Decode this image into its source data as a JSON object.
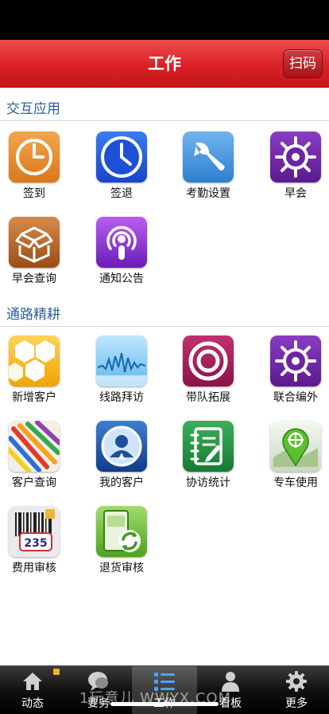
{
  "header": {
    "title": "工作",
    "scan_label": "扫码"
  },
  "sections": [
    {
      "title": "交互应用",
      "items": [
        {
          "label": "签到",
          "icon": "clock-icon"
        },
        {
          "label": "签退",
          "icon": "clock-icon"
        },
        {
          "label": "考勤设置",
          "icon": "wrench-icon"
        },
        {
          "label": "早会",
          "icon": "helm-icon"
        },
        {
          "label": "早会查询",
          "icon": "box-icon"
        },
        {
          "label": "通知公告",
          "icon": "podcast-icon"
        }
      ]
    },
    {
      "title": "通路精耕",
      "items": [
        {
          "label": "新增客户",
          "icon": "hexagon-icon"
        },
        {
          "label": "线路拜访",
          "icon": "waveform-icon"
        },
        {
          "label": "带队拓展",
          "icon": "ring-icon"
        },
        {
          "label": "联合编外",
          "icon": "helm-icon"
        },
        {
          "label": "客户查询",
          "icon": "pencils-icon"
        },
        {
          "label": "我的客户",
          "icon": "user-icon"
        },
        {
          "label": "协访统计",
          "icon": "notebook-icon"
        },
        {
          "label": "专车使用",
          "icon": "map-pin-icon"
        },
        {
          "label": "费用审核",
          "icon": "barcode-icon"
        },
        {
          "label": "退货审核",
          "icon": "refresh-icon"
        }
      ]
    }
  ],
  "tabbar": [
    {
      "label": "动态",
      "icon": "home-icon",
      "active": false
    },
    {
      "label": "要务",
      "icon": "chat-icon",
      "active": false
    },
    {
      "label": "工作",
      "icon": "list-icon",
      "active": true
    },
    {
      "label": "看板",
      "icon": "person-icon",
      "active": false
    },
    {
      "label": "更多",
      "icon": "gear-icon",
      "active": false
    }
  ],
  "watermark": "1玩意儿 WWYX.COM"
}
